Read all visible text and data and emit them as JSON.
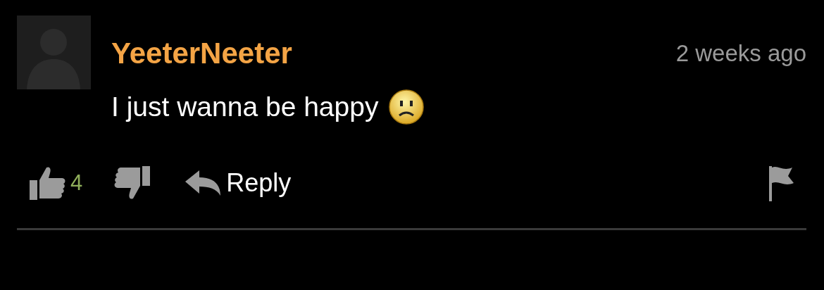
{
  "comment": {
    "username": "YeeterNeeter",
    "time": "2 weeks ago",
    "text": "I just wanna be happy",
    "likes": "4",
    "reply_label": "Reply"
  }
}
